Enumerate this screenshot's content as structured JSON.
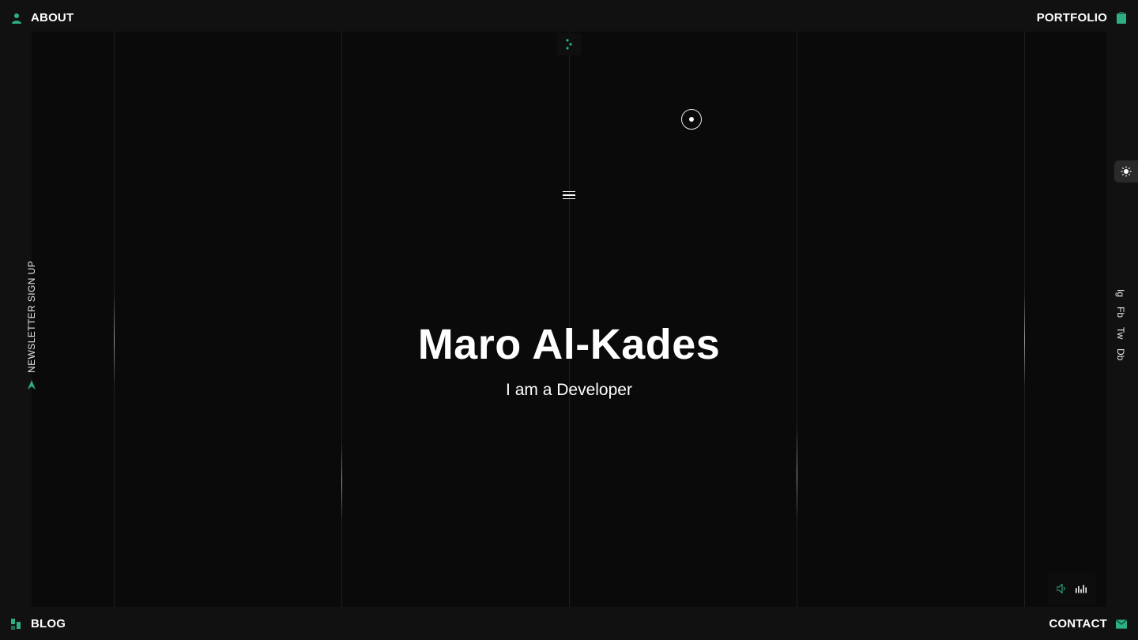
{
  "nav": {
    "about": "ABOUT",
    "portfolio": "PORTFOLIO",
    "blog": "BLOG",
    "contact": "CONTACT"
  },
  "newsletter": {
    "label": "NEWSLETTER SIGN UP"
  },
  "social": [
    {
      "label": "Ig"
    },
    {
      "label": "Fb"
    },
    {
      "label": "Tw"
    },
    {
      "label": "Db"
    }
  ],
  "hero": {
    "name": "Maro Al-Kades",
    "role": "I am a Developer"
  },
  "icons": {
    "about": "user-icon",
    "portfolio": "clipboard-icon",
    "blog": "grid-icon",
    "contact": "mail-icon",
    "newsletter": "send-arrow-icon",
    "theme": "sun-icon",
    "menu": "hamburger-icon",
    "audio": "speaker-icon",
    "equalizer": "equalizer-icon"
  },
  "colors": {
    "accent": "#2fae84",
    "background": "#0a0a0a",
    "frame": "#111111",
    "text": "#ffffff"
  }
}
